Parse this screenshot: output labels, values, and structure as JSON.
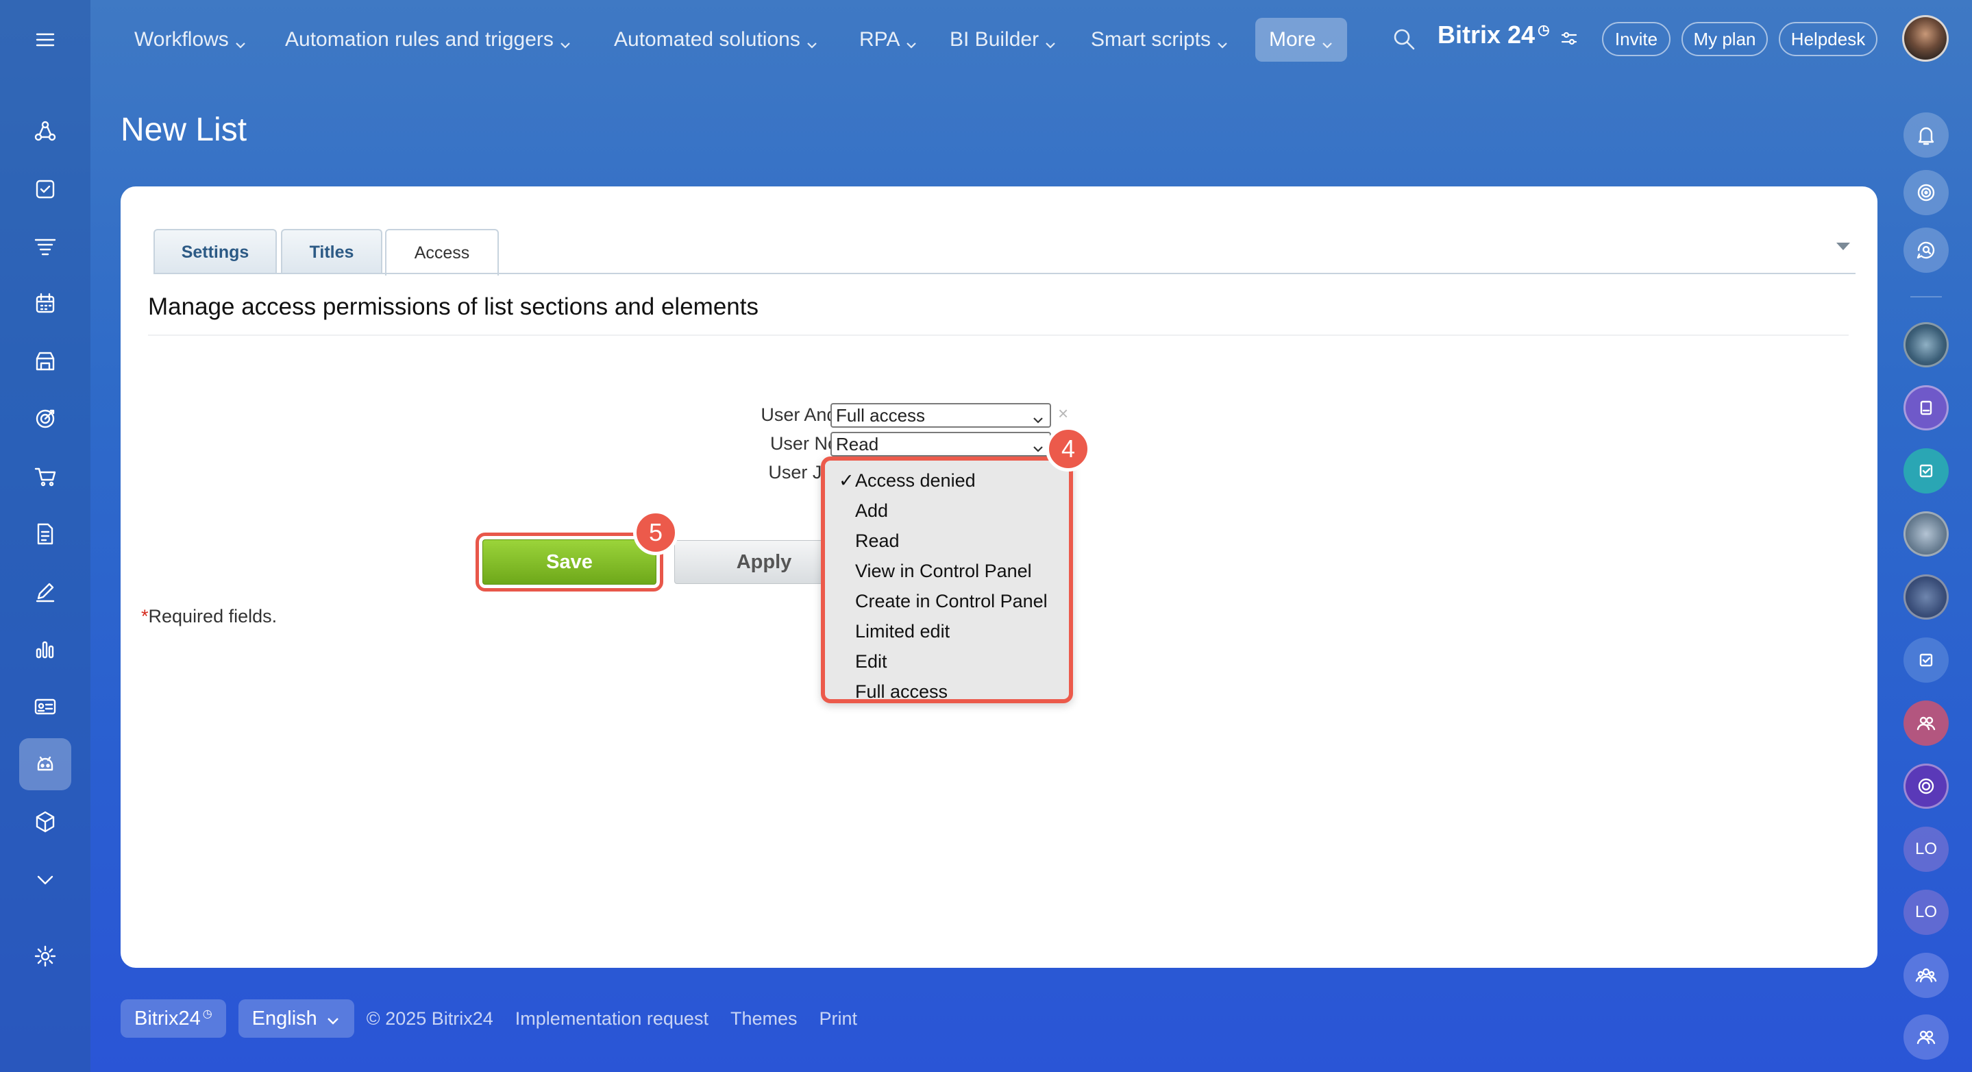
{
  "top_nav": {
    "items": [
      {
        "label": "Workflows"
      },
      {
        "label": "Automation rules and triggers"
      },
      {
        "label": "Automated solutions"
      },
      {
        "label": "RPA"
      },
      {
        "label": "BI Builder"
      },
      {
        "label": "Smart scripts"
      },
      {
        "label": "More"
      }
    ],
    "brand": "Bitrix 24",
    "invite_label": "Invite",
    "my_plan_label": "My plan",
    "helpdesk_label": "Helpdesk"
  },
  "page": {
    "title": "New List"
  },
  "tabs": [
    {
      "label": "Settings"
    },
    {
      "label": "Titles"
    },
    {
      "label": "Access"
    }
  ],
  "access": {
    "section_title": "Manage access permissions of list sections and elements",
    "rows": [
      {
        "label": "User Andrew Baxter:",
        "value": "Full access"
      },
      {
        "label": "User Norma Porter:",
        "value": "Read"
      },
      {
        "label": "User Justin Testard",
        "value": ""
      }
    ],
    "remove_symbol": "×"
  },
  "dropdown": {
    "check": "✓",
    "selected": "Access denied",
    "options": [
      "Access denied",
      "Add",
      "Read",
      "View in Control Panel",
      "Create in Control Panel",
      "Limited edit",
      "Edit",
      "Full access"
    ]
  },
  "buttons": {
    "save": "Save",
    "apply": "Apply"
  },
  "required_note": {
    "star": "*",
    "text": "Required fields."
  },
  "badges": {
    "step4": "4",
    "step5": "5"
  },
  "right_sidebar": {
    "lo1": "LO",
    "lo2": "LO"
  },
  "footer": {
    "brand": "Bitrix24",
    "language": "English",
    "copyright": "© 2025 Bitrix24",
    "links": [
      "Implementation request",
      "Themes",
      "Print"
    ]
  },
  "colors": {
    "accent_red": "#ec5a4b",
    "save_green": "#7cb823",
    "tab_text": "#2c5a85"
  }
}
